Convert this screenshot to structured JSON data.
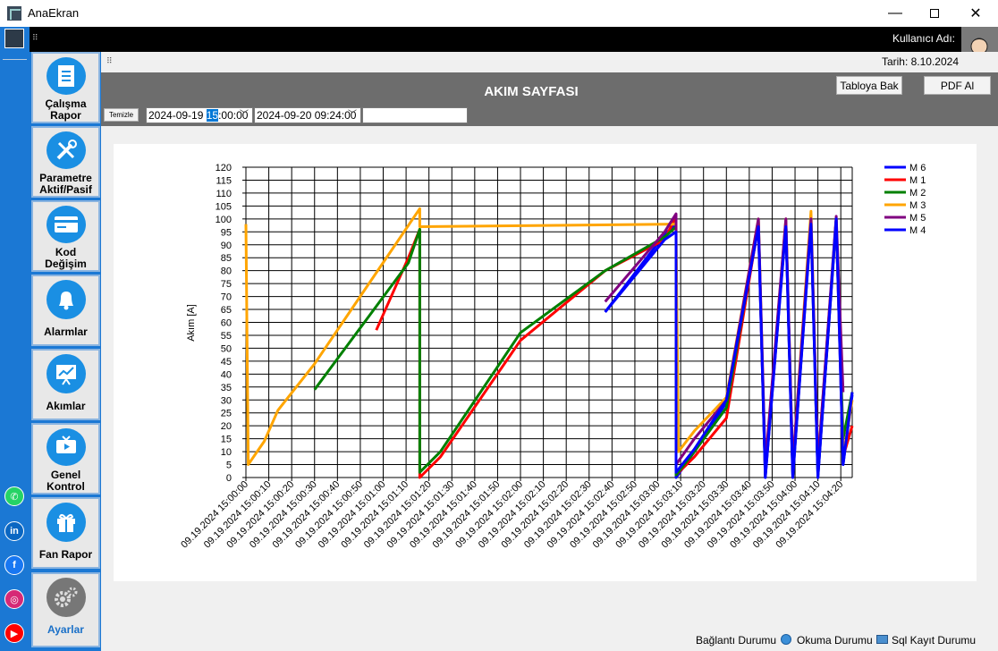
{
  "window": {
    "title": "AnaEkran",
    "min_icon": "minimize-icon",
    "max_icon": "maximize-icon",
    "close_icon": "close-icon"
  },
  "topbar": {
    "user_label": "Kullanıcı Adı:"
  },
  "subbar": {
    "date_label": "Tarih: 8.10.2024"
  },
  "header": {
    "title": "AKIM SAYFASI",
    "table_button": "Tabloya Bak",
    "pdf_button": "PDF Al",
    "clear_button": "Temizle",
    "start_prefix": "2024-09-19 ",
    "start_hour": "15",
    "start_suffix": ":00:00",
    "end_value": "2024-09-20 09:24:00",
    "filter_value": ""
  },
  "sidebar": {
    "items": [
      {
        "label": "Çalışma Rapor",
        "icon": "document-icon"
      },
      {
        "label": "Parametre Aktif/Pasif",
        "icon": "tools-icon"
      },
      {
        "label": "Kod Değişim",
        "icon": "card-icon"
      },
      {
        "label": "Alarmlar",
        "icon": "bell-icon"
      },
      {
        "label": "Akımlar",
        "icon": "chart-board-icon"
      },
      {
        "label": "Genel Kontrol",
        "icon": "monitor-icon"
      },
      {
        "label": "Fan Rapor",
        "icon": "gift-icon"
      },
      {
        "label": "Ayarlar",
        "icon": "gears-icon"
      }
    ],
    "social": [
      "whatsapp-icon",
      "linkedin-icon",
      "facebook-icon",
      "instagram-icon",
      "youtube-icon"
    ]
  },
  "status": {
    "connection": "Bağlantı Durumu",
    "reading": "Okuma Durumu",
    "sql": "Sql Kayıt Durumu"
  },
  "chart_data": {
    "type": "line",
    "title": "",
    "xlabel": "",
    "ylabel": "Akım [A]",
    "ylim": [
      0,
      120
    ],
    "yticks": [
      0,
      5,
      10,
      15,
      20,
      25,
      30,
      35,
      40,
      45,
      50,
      55,
      60,
      65,
      70,
      75,
      80,
      85,
      90,
      95,
      100,
      105,
      110,
      115,
      120
    ],
    "xlim_seconds": [
      0,
      265
    ],
    "x_tick_labels": [
      "09.19.2024 15:00:00",
      "09.19.2024 15:00:10",
      "09.19.2024 15:00:20",
      "09.19.2024 15:00:30",
      "09.19.2024 15:00:40",
      "09.19.2024 15:00:50",
      "09.19.2024 15:01:00",
      "09.19.2024 15:01:10",
      "09.19.2024 15:01:20",
      "09.19.2024 15:01:30",
      "09.19.2024 15:01:40",
      "09.19.2024 15:01:50",
      "09.19.2024 15:02:00",
      "09.19.2024 15:02:10",
      "09.19.2024 15:02:20",
      "09.19.2024 15:02:30",
      "09.19.2024 15:02:40",
      "09.19.2024 15:02:50",
      "09.19.2024 15:03:00",
      "09.19.2024 15:03:10",
      "09.19.2024 15:03:20",
      "09.19.2024 15:03:30",
      "09.19.2024 15:03:40",
      "09.19.2024 15:03:50",
      "09.19.2024 15:04:00",
      "09.19.2024 15:04:10",
      "09.19.2024 15:04:20"
    ],
    "grid": true,
    "legend_position": "right-top",
    "series": [
      {
        "name": "M 6",
        "color": "#0000ff",
        "points": [
          [
            157,
            64
          ],
          [
            183,
            94
          ],
          [
            188,
            98
          ],
          [
            188,
            0
          ],
          [
            196,
            10
          ],
          [
            210,
            29
          ],
          [
            224,
            97
          ],
          [
            227,
            0
          ],
          [
            236,
            98
          ],
          [
            239,
            0
          ],
          [
            247,
            99
          ],
          [
            250,
            0
          ],
          [
            258,
            99
          ],
          [
            261,
            5
          ],
          [
            265,
            32
          ]
        ]
      },
      {
        "name": "M 1",
        "color": "#ff0000",
        "points": [
          [
            57,
            57
          ],
          [
            71,
            85
          ],
          [
            76,
            96
          ],
          [
            76,
            0
          ],
          [
            85,
            8
          ],
          [
            120,
            53
          ],
          [
            157,
            80
          ],
          [
            183,
            92
          ],
          [
            188,
            101
          ],
          [
            188,
            1
          ],
          [
            196,
            8
          ],
          [
            210,
            23
          ],
          [
            224,
            98
          ],
          [
            227,
            1
          ],
          [
            236,
            99
          ],
          [
            239,
            2
          ],
          [
            247,
            100
          ],
          [
            250,
            4
          ],
          [
            258,
            100
          ],
          [
            261,
            8
          ],
          [
            265,
            20
          ]
        ]
      },
      {
        "name": "M 2",
        "color": "#008000",
        "points": [
          [
            30,
            34
          ],
          [
            71,
            83
          ],
          [
            76,
            96
          ],
          [
            76,
            2
          ],
          [
            85,
            10
          ],
          [
            120,
            56
          ],
          [
            157,
            80
          ],
          [
            183,
            93
          ],
          [
            188,
            97
          ],
          [
            188,
            1
          ],
          [
            196,
            10
          ],
          [
            210,
            27
          ],
          [
            224,
            99
          ],
          [
            227,
            1
          ],
          [
            236,
            99
          ],
          [
            239,
            1
          ],
          [
            247,
            100
          ],
          [
            250,
            1
          ],
          [
            258,
            100
          ],
          [
            261,
            15
          ],
          [
            265,
            33
          ]
        ]
      },
      {
        "name": "M 3",
        "color": "#ffa500",
        "points": [
          [
            0,
            98
          ],
          [
            1,
            5
          ],
          [
            8,
            14
          ],
          [
            14,
            26
          ],
          [
            30,
            44
          ],
          [
            76,
            104
          ],
          [
            76,
            97
          ],
          [
            188,
            98
          ],
          [
            189,
            10
          ],
          [
            196,
            18
          ],
          [
            210,
            31
          ],
          [
            224,
            100
          ],
          [
            227,
            3
          ],
          [
            236,
            100
          ],
          [
            239,
            5
          ],
          [
            247,
            103
          ],
          [
            250,
            5
          ],
          [
            258,
            100
          ],
          [
            261,
            8
          ],
          [
            265,
            30
          ]
        ]
      },
      {
        "name": "M 5",
        "color": "#800080",
        "points": [
          [
            157,
            68
          ],
          [
            183,
            95
          ],
          [
            188,
            102
          ],
          [
            188,
            5
          ],
          [
            196,
            15
          ],
          [
            210,
            30
          ],
          [
            224,
            100
          ],
          [
            227,
            5
          ],
          [
            236,
            100
          ],
          [
            239,
            5
          ],
          [
            247,
            100
          ],
          [
            250,
            5
          ],
          [
            258,
            101
          ],
          [
            261,
            33
          ]
        ]
      },
      {
        "name": "M 4",
        "color": "#0000ff",
        "points": [
          [
            157,
            64
          ],
          [
            183,
            92
          ],
          [
            188,
            95
          ],
          [
            188,
            2
          ],
          [
            196,
            11
          ],
          [
            210,
            30
          ],
          [
            224,
            97
          ],
          [
            227,
            0
          ],
          [
            236,
            97
          ],
          [
            239,
            0
          ],
          [
            247,
            98
          ],
          [
            250,
            0
          ],
          [
            258,
            100
          ],
          [
            261,
            5
          ],
          [
            265,
            33
          ]
        ]
      }
    ]
  }
}
